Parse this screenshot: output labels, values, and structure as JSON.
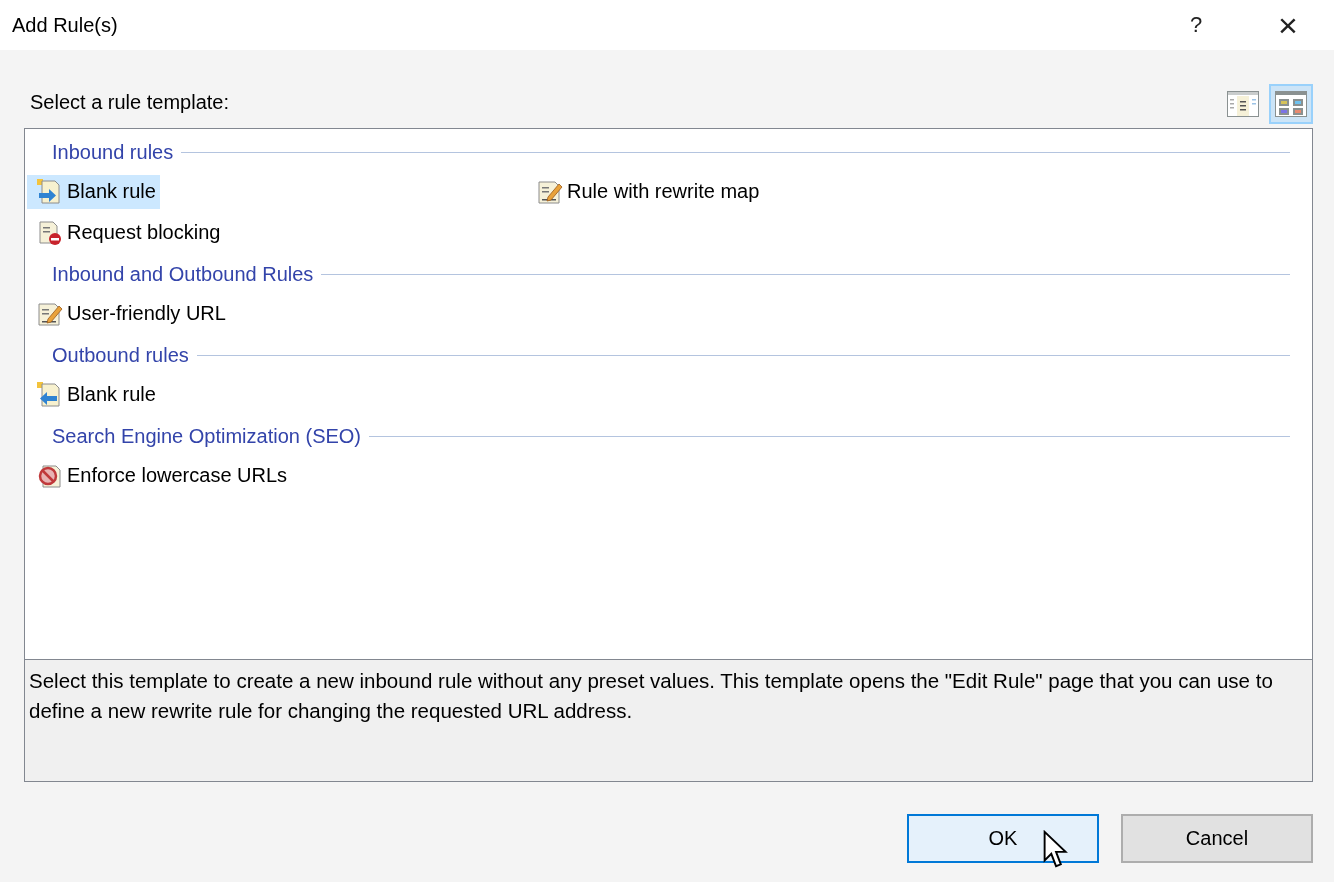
{
  "window": {
    "title": "Add Rule(s)",
    "help": "?",
    "close": "×"
  },
  "prompt": "Select a rule template:",
  "views": [
    {
      "kind": "details",
      "selected": false
    },
    {
      "kind": "tiles",
      "selected": true
    }
  ],
  "groups": [
    {
      "title": "Inbound rules",
      "items": [
        {
          "kind": "inbound-blank",
          "label": "Blank rule",
          "selected": true
        },
        {
          "kind": "rewrite",
          "label": "Rule with rewrite map",
          "selected": false
        },
        {
          "kind": "blocking",
          "label": "Request blocking",
          "selected": false
        }
      ]
    },
    {
      "title": "Inbound and Outbound Rules",
      "items": [
        {
          "kind": "rewrite",
          "label": "User-friendly URL",
          "selected": false
        }
      ]
    },
    {
      "title": "Outbound rules",
      "items": [
        {
          "kind": "outbound-blank",
          "label": "Blank rule",
          "selected": false
        }
      ]
    },
    {
      "title": "Search Engine Optimization (SEO)",
      "items": [
        {
          "kind": "lowercase",
          "label": "Enforce lowercase URLs",
          "selected": false
        }
      ]
    }
  ],
  "description": "Select this template to create a new inbound rule without any preset values. This template opens the \"Edit Rule\" page that you can use to define a new rewrite rule for changing the requested URL address.",
  "buttons": [
    {
      "label": "OK",
      "focused": true
    },
    {
      "label": "Cancel",
      "focused": false
    }
  ]
}
